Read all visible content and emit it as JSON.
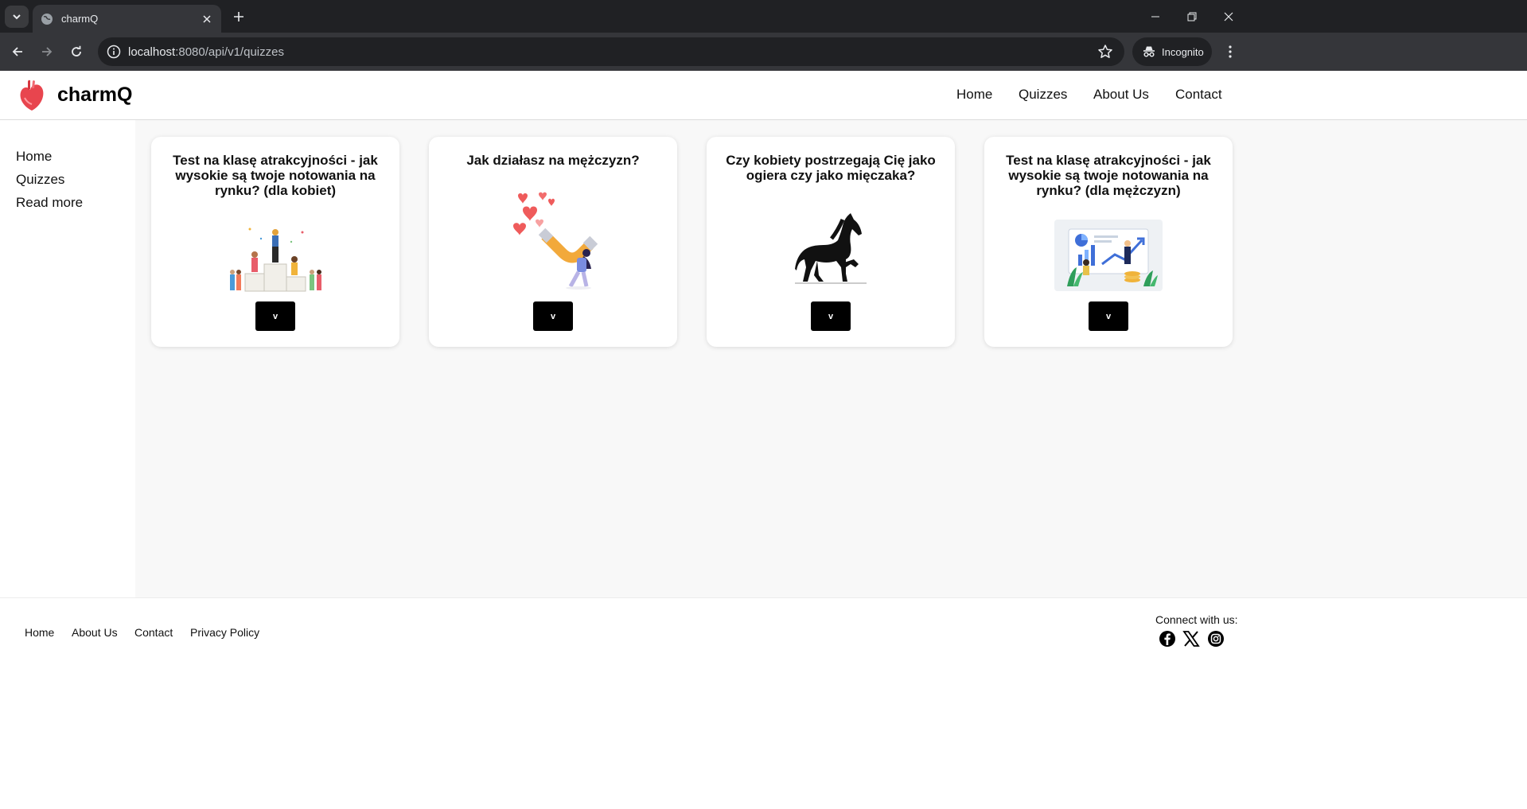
{
  "browser": {
    "tab_title": "charmQ",
    "url_host": "localhost",
    "url_path": ":8080/api/v1/quizzes",
    "profile_label": "Incognito"
  },
  "header": {
    "brand": "charmQ",
    "nav": [
      "Home",
      "Quizzes",
      "About Us",
      "Contact"
    ]
  },
  "sidebar": {
    "items": [
      "Home",
      "Quizzes",
      "Read more"
    ]
  },
  "quizzes": [
    {
      "title": "Test na klasę atrakcyjności - jak wysokie są twoje notowania na rynku? (dla kobiet)",
      "button": "v",
      "image": "podium-winners-illustration"
    },
    {
      "title": "Jak działasz na mężczyzn?",
      "button": "v",
      "image": "heart-magnet-illustration"
    },
    {
      "title": "Czy kobiety postrzegają Cię jako ogiera czy jako mięczaka?",
      "button": "v",
      "image": "black-horse-silhouette"
    },
    {
      "title": "Test na klasę atrakcyjności - jak wysokie są twoje notowania na rynku? (dla mężczyzn)",
      "button": "v",
      "image": "growth-chart-illustration"
    }
  ],
  "footer": {
    "links": [
      "Home",
      "About Us",
      "Contact",
      "Privacy Policy"
    ],
    "connect_label": "Connect with us:",
    "social": [
      "facebook-icon",
      "x-icon",
      "instagram-icon"
    ]
  },
  "colors": {
    "brand_red": "#e8454e",
    "button_black": "#000000",
    "main_bg": "#f8f8f8"
  }
}
